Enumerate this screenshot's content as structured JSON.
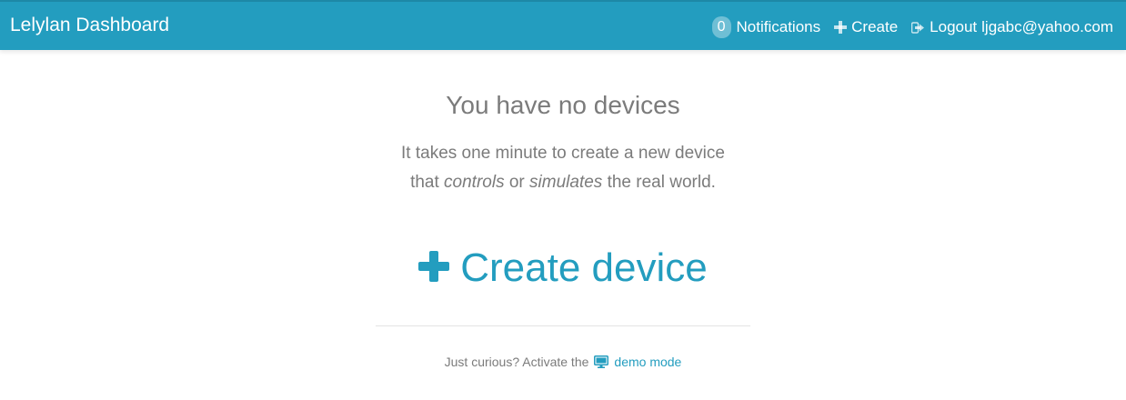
{
  "header": {
    "brand": "Lelylan Dashboard",
    "notifications": {
      "count": "0",
      "label": "Notifications"
    },
    "create_label": "Create",
    "logout_label": "Logout",
    "user_email": "ljgabc@yahoo.com",
    "icons": {
      "create": "plus-icon",
      "logout": "logout-icon"
    }
  },
  "empty_state": {
    "title": "You have no devices",
    "line1": "It takes one minute to create a new device",
    "line2_prefix": "that",
    "line2_em1": "controls",
    "line2_mid": "or",
    "line2_em2": "simulates",
    "line2_suffix": "the real world.",
    "create_button": "Create device",
    "create_icon": "plus-icon"
  },
  "footer": {
    "prompt": "Just curious? Activate the",
    "demo_link": "demo mode",
    "demo_icon": "monitor-icon"
  },
  "colors": {
    "accent": "#239dbf",
    "text_muted": "#7b7b7b"
  }
}
